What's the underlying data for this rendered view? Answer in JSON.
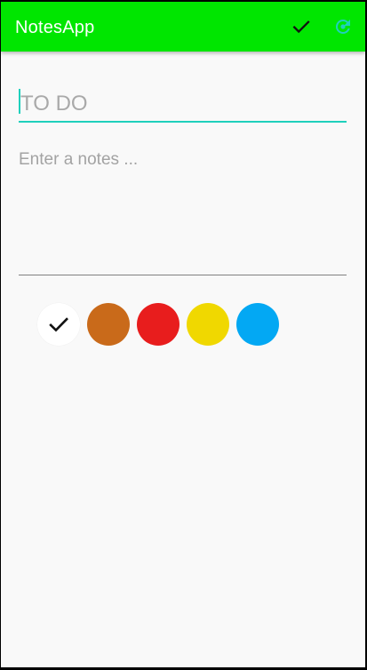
{
  "app": {
    "title": "NotesApp"
  },
  "colors": {
    "app_bar": "#00e600",
    "accent": "#1fd0bc",
    "background": "#f9f9f9"
  },
  "toolbar": {
    "actions": [
      {
        "name": "save",
        "icon": "check-icon",
        "color": "#111111"
      },
      {
        "name": "refresh",
        "icon": "refresh-icon",
        "color": "#1fd0bc"
      }
    ]
  },
  "form": {
    "title_placeholder": "TO DO",
    "notes_placeholder": "Enter a notes ..."
  },
  "color_options": [
    {
      "name": "white",
      "hex": "#ffffff",
      "selected": true
    },
    {
      "name": "brown",
      "hex": "#c96a1a",
      "selected": false
    },
    {
      "name": "red",
      "hex": "#e81d1d",
      "selected": false
    },
    {
      "name": "yellow",
      "hex": "#f0d800",
      "selected": false
    },
    {
      "name": "blue",
      "hex": "#03a8f3",
      "selected": false
    }
  ]
}
